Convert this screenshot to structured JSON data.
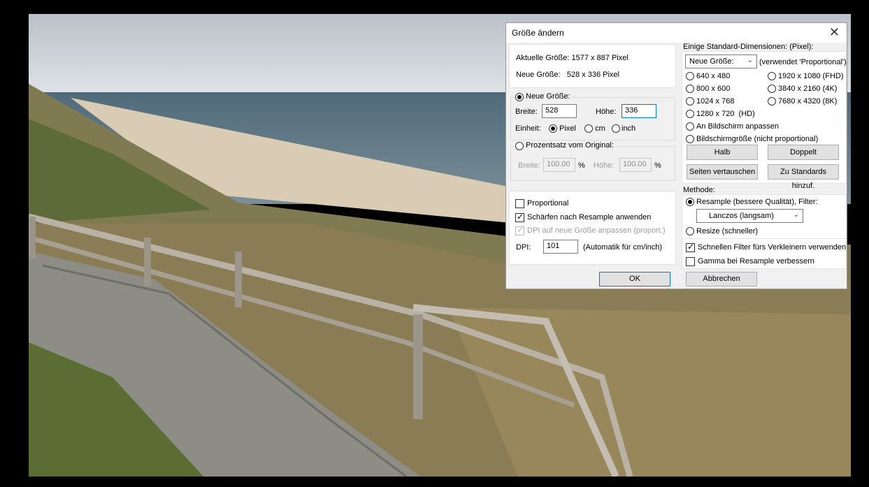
{
  "dialog": {
    "title": "Größe ändern",
    "close_glyph": "✕",
    "current_size": "Aktuelle Größe: 1577 x 887 Pixel",
    "new_size": "Neue Größe:   528 x 336 Pixel",
    "new_size_radio": "Neue Größe:",
    "width_label": "Breite:",
    "width_value": "528",
    "height_label": "Höhe:",
    "height_value": "336",
    "unit_label": "Einheit:",
    "unit_pixel": "Pixel",
    "unit_cm": "cm",
    "unit_inch": "inch",
    "percent_radio": "Prozentsatz vom Original:",
    "pct_width_label": "Breite:",
    "pct_width_value": "100.00",
    "pct_sign": "%",
    "pct_height_label": "Höhe:",
    "pct_height_value": "100.00",
    "proportional": "Proportional",
    "sharpen": "Schärfen nach Resample anwenden",
    "dpi_adjust": "DPI auf neue Größe anpassen (proport.)",
    "dpi_label": "DPI:",
    "dpi_value": "101",
    "dpi_note": "(Automatik für cm/inch)",
    "std_title": "Einige Standard-Dimensionen: (Pixel):",
    "std_combo": "Neue Größe:",
    "std_combo_note": "(verwendet 'Proportional')",
    "res_640": "640 x 480",
    "res_800": "800 x 600",
    "res_1024": "1024 x 768",
    "res_1280": "1280 x 720  (HD)",
    "res_1920": "1920 x 1080 (FHD)",
    "res_3840": "3840 x 2160 (4K)",
    "res_7680": "7680 x 4320 (8K)",
    "fit_screen": "An Bildschirm anpassen",
    "screen_size": "Bildschirmgröße (nicht proportional)",
    "half_btn": "Halb",
    "double_btn": "Doppelt",
    "swap_btn": "Seiten vertauschen",
    "add_std_btn": "Zu Standards hinzuf.",
    "method_title": "Methode:",
    "resample_radio": "Resample (bessere Qualität), Filter:",
    "filter_value": "Lanczos (langsam)",
    "resize_radio": "Resize (schneller)",
    "fast_filter": "Schnellen Filter fürs Verkleinern verwenden",
    "gamma": "Gamma bei Resample verbessern",
    "ok_btn": "OK",
    "cancel_btn": "Abbrechen"
  }
}
